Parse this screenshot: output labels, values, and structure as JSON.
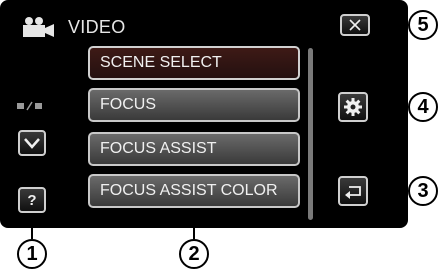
{
  "header": {
    "title": "VIDEO",
    "title_icon": "video-camera-icon"
  },
  "menu": {
    "items": [
      {
        "label": "SCENE SELECT"
      },
      {
        "label": "FOCUS"
      },
      {
        "label": "FOCUS ASSIST"
      },
      {
        "label": "FOCUS ASSIST COLOR"
      }
    ]
  },
  "left_panel": {
    "page_indicator_icon": "page-indicator-icon",
    "scroll_down_icon": "chevron-down-icon",
    "help_label": "?"
  },
  "right_panel": {
    "close_icon": "close-icon",
    "settings_icon": "gear-icon",
    "back_icon": "return-icon"
  },
  "callouts": [
    "1",
    "2",
    "3",
    "4",
    "5"
  ],
  "colors": {
    "screen_background": "#000000",
    "button_border": "#c8c8c8",
    "selected_item": "#3e1a16"
  }
}
